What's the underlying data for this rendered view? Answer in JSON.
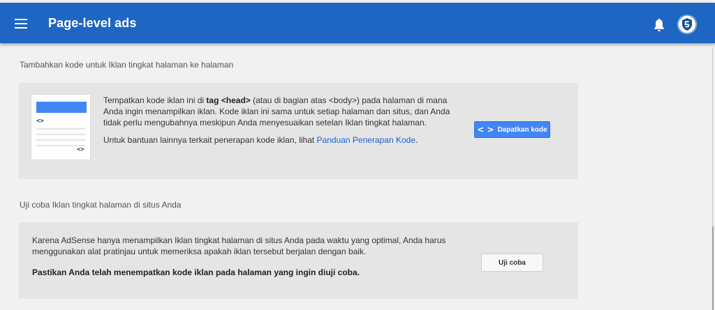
{
  "header": {
    "title": "Page-level ads"
  },
  "section1": {
    "heading": "Tambahkan kode untuk Iklan tingkat halaman ke halaman",
    "text_before_head": "Tempatkan kode iklan ini di ",
    "tag_label": "tag <head>",
    "text_after_head": " (atau di bagian atas <body>) pada halaman di mana Anda ingin menampilkan iklan. Kode iklan ini sama untuk setiap halaman dan situs, dan Anda tidak perlu mengubahnya meskipun Anda menyesuaikan setelan Iklan tingkat halaman.",
    "help_text": "Untuk bantuan lainnya terkait penerapan kode iklan, lihat ",
    "help_link": "Panduan Penerapan Kode",
    "help_end": ".",
    "thumb_code_1": "<>",
    "thumb_code_2": "<>",
    "button_icon": "< >",
    "button_label": "Dapatkan kode"
  },
  "section2": {
    "heading": "Uji coba Iklan tingkat halaman di situs Anda",
    "text": "Karena AdSense hanya menampilkan Iklan tingkat halaman di situs Anda pada waktu yang optimal, Anda harus menggunakan alat pratinjau untuk memeriksa apakah iklan tersebut berjalan dengan baik.",
    "note": "Pastikan Anda telah menempatkan kode iklan pada halaman yang ingin diuji coba.",
    "button_label": "Uji coba"
  },
  "colors": {
    "header_bg": "#1e66c2",
    "primary_button": "#4285f4",
    "link": "#1a5fd1",
    "card_bg": "#e5e5e5",
    "page_bg": "#f1f1f1"
  },
  "icons": [
    "menu-icon",
    "bell-icon",
    "avatar-shield-icon",
    "code-icon"
  ]
}
